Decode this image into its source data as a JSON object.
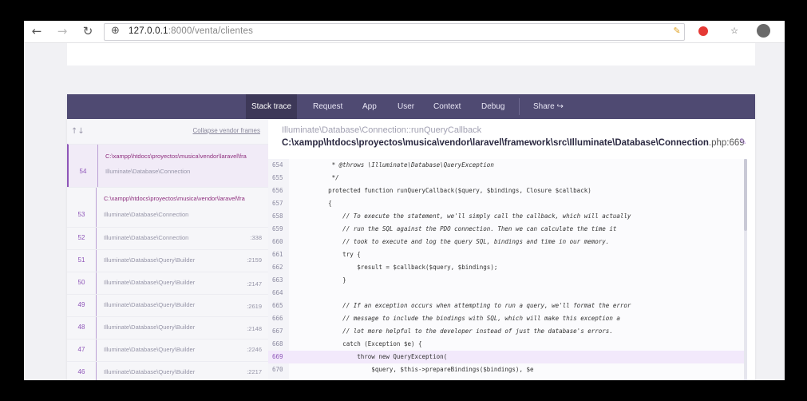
{
  "browser": {
    "url_host": "127.0.0.1",
    "url_path": ":8000/venta/clientes",
    "back_icon": "arrow-left-icon",
    "forward_icon": "arrow-right-icon",
    "reload_icon": "reload-icon"
  },
  "tabs": [
    {
      "label": "Stack trace",
      "active": true
    },
    {
      "label": "Request"
    },
    {
      "label": "App"
    },
    {
      "label": "User"
    },
    {
      "label": "Context"
    },
    {
      "label": "Debug"
    },
    {
      "label": "Share"
    }
  ],
  "share_arrow": "↪",
  "left_pane": {
    "arrows": "↑↓",
    "collapse_label": "Collapse vendor frames"
  },
  "frames": [
    {
      "path": "C:\\xampp\\htdocs\\proyectos\\musica\\vendor\\laravel\\fra",
      "num": "54",
      "cls": "Illuminate\\Database\\Connection",
      "line": ""
    },
    {
      "path": "C:\\xampp\\htdocs\\proyectos\\musica\\vendor\\laravel\\fra",
      "num": "53",
      "cls": "Illuminate\\Database\\Connection",
      "line": ""
    },
    {
      "num": "52",
      "cls": "Illuminate\\Database\\Connection",
      "line": ":338"
    },
    {
      "num": "51",
      "cls": "Illuminate\\Database\\Query\\Builder",
      "line": ":2159"
    },
    {
      "num": "50",
      "cls": "Illuminate\\Database\\Query\\Builder",
      "line": ":2147"
    },
    {
      "num": "49",
      "cls": "Illuminate\\Database\\Query\\Builder",
      "line": ":2619"
    },
    {
      "num": "48",
      "cls": "Illuminate\\Database\\Query\\Builder",
      "line": ":2148"
    },
    {
      "num": "47",
      "cls": "Illuminate\\Database\\Query\\Builder",
      "line": ":2246"
    },
    {
      "num": "46",
      "cls": "Illuminate\\Database\\Query\\Builder",
      "line": ":2217"
    }
  ],
  "location": {
    "class": "Illuminate\\Database\\Connection::runQueryCallback",
    "file": "C:\\xampp\\htdocs\\proyectos\\musica\\vendor\\laravel\\framework\\src\\Illuminate\\Database\\Connection",
    "ext_line": ".php:669"
  },
  "code_lines": [
    {
      "no": "654",
      "src": "         * @throws \\Illuminate\\Database\\QueryException"
    },
    {
      "no": "655",
      "src": "         */"
    },
    {
      "no": "656",
      "src": "        protected function runQueryCallback($query, $bindings, Closure $callback)"
    },
    {
      "no": "657",
      "src": "        {"
    },
    {
      "no": "658",
      "src": "            // To execute the statement, we'll simply call the callback, which will actually"
    },
    {
      "no": "659",
      "src": "            // run the SQL against the PDO connection. Then we can calculate the time it"
    },
    {
      "no": "660",
      "src": "            // took to execute and log the query SQL, bindings and time in our memory."
    },
    {
      "no": "661",
      "src": "            try {"
    },
    {
      "no": "662",
      "src": "                $result = $callback($query, $bindings);"
    },
    {
      "no": "663",
      "src": "            }"
    },
    {
      "no": "664",
      "src": ""
    },
    {
      "no": "665",
      "src": "            // If an exception occurs when attempting to run a query, we'll format the error"
    },
    {
      "no": "666",
      "src": "            // message to include the bindings with SQL, which will make this exception a"
    },
    {
      "no": "667",
      "src": "            // lot more helpful to the developer instead of just the database's errors."
    },
    {
      "no": "668",
      "src": "            catch (Exception $e) {"
    },
    {
      "no": "669",
      "src": "                throw new QueryException(",
      "hl": true
    },
    {
      "no": "670",
      "src": "                    $query, $this->prepareBindings($bindings), $e"
    }
  ]
}
